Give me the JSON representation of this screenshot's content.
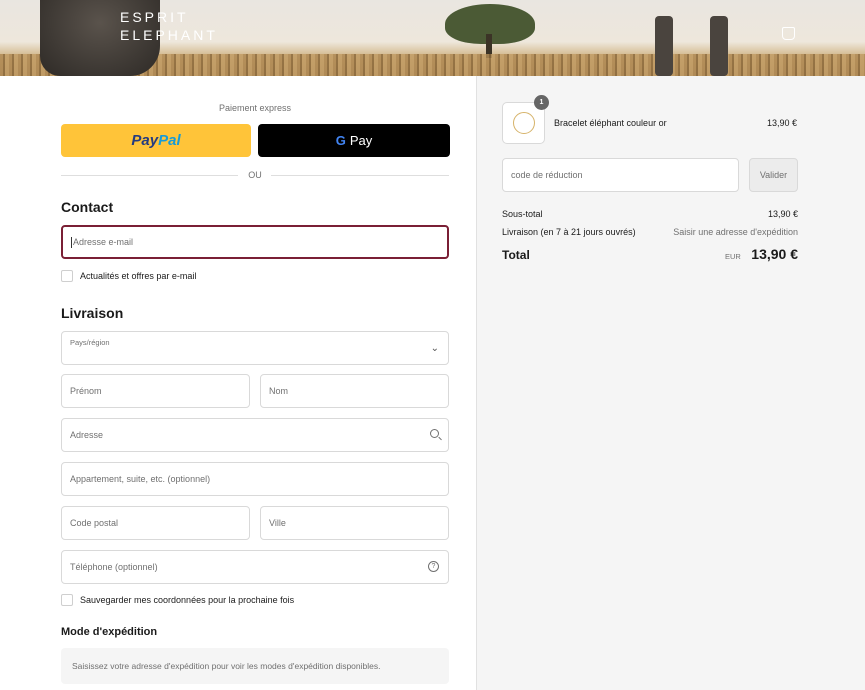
{
  "banner": {
    "logo_line1": "ESPRIT",
    "logo_line2": "ELEPHANT"
  },
  "express": {
    "label": "Paiement express",
    "paypal_a": "Pay",
    "paypal_b": "Pal",
    "gpay_g": "G",
    "gpay_label": "Pay",
    "or": "OU"
  },
  "contact": {
    "title": "Contact",
    "email_placeholder": "Adresse e-mail",
    "newsletter_label": "Actualités et offres par e-mail"
  },
  "delivery": {
    "title": "Livraison",
    "country_label": "Pays/région",
    "first_name": "Prénom",
    "last_name": "Nom",
    "address": "Adresse",
    "apartment": "Appartement, suite, etc. (optionnel)",
    "postal_code": "Code postal",
    "city": "Ville",
    "phone": "Téléphone (optionnel)",
    "help_glyph": "?",
    "save_label": "Sauvegarder mes coordonnées pour la prochaine fois"
  },
  "shipping": {
    "title": "Mode d'expédition",
    "info": "Saisissez votre adresse d'expédition pour voir les modes d'expédition disponibles."
  },
  "summary": {
    "quantity": "1",
    "product_name": "Bracelet éléphant couleur or",
    "product_price": "13,90 €",
    "discount_placeholder": "code de réduction",
    "apply_label": "Valider",
    "subtotal_label": "Sous-total",
    "subtotal_value": "13,90 €",
    "shipping_label": "Livraison (en 7 à 21 jours ouvrés)",
    "shipping_value": "Saisir une adresse d'expédition",
    "total_label": "Total",
    "currency": "EUR",
    "total_value": "13,90 €"
  }
}
